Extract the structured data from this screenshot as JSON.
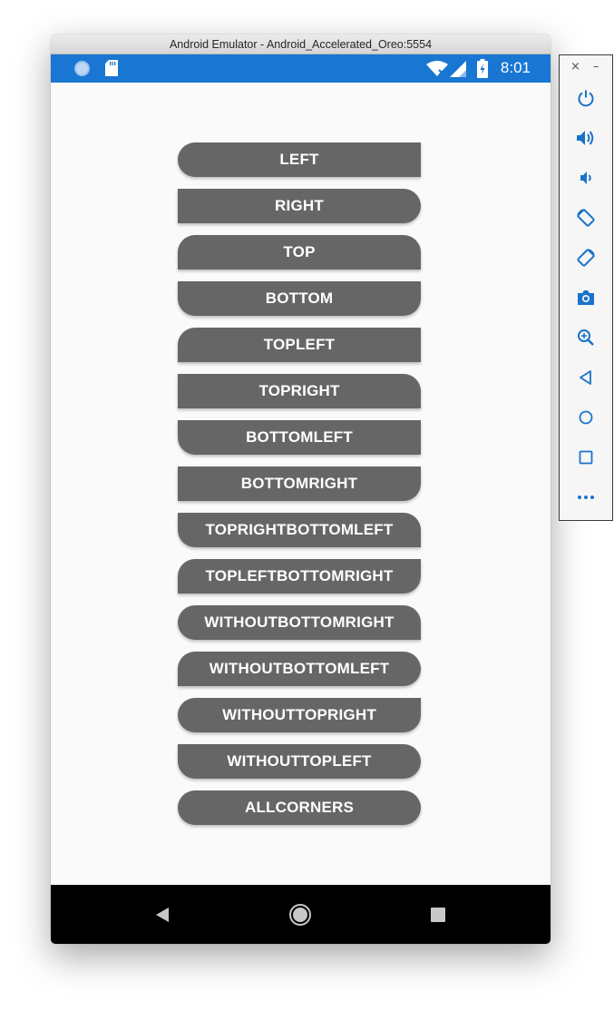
{
  "window": {
    "title": "Android Emulator - Android_Accelerated_Oreo:5554"
  },
  "status_bar": {
    "time": "8:01",
    "color": "#1976d2"
  },
  "buttons": [
    {
      "label": "LEFT"
    },
    {
      "label": "RIGHT"
    },
    {
      "label": "TOP"
    },
    {
      "label": "BOTTOM"
    },
    {
      "label": "TOPLEFT"
    },
    {
      "label": "TOPRIGHT"
    },
    {
      "label": "BOTTOMLEFT"
    },
    {
      "label": "BOTTOMRIGHT"
    },
    {
      "label": "TOPRIGHTBOTTOMLEFT"
    },
    {
      "label": "TOPLEFTBOTTOMRIGHT"
    },
    {
      "label": "WITHOUTBOTTOMRIGHT"
    },
    {
      "label": "WITHOUTBOTTOMLEFT"
    },
    {
      "label": "WITHOUTTOPRIGHT"
    },
    {
      "label": "WITHOUTTOPLEFT"
    },
    {
      "label": "ALLCORNERS"
    }
  ],
  "button_style": {
    "background": "#666666",
    "text_color": "#ffffff"
  },
  "nav_bar": {
    "icons": [
      "back-icon",
      "home-icon",
      "recents-icon"
    ]
  },
  "tool_panel": {
    "close_label": "×",
    "minimize_label": "–",
    "tools": [
      "power-icon",
      "volume-up-icon",
      "volume-down-icon",
      "rotate-left-icon",
      "rotate-right-icon",
      "camera-icon",
      "zoom-icon",
      "back-icon",
      "home-icon",
      "overview-icon",
      "more-icon"
    ]
  }
}
